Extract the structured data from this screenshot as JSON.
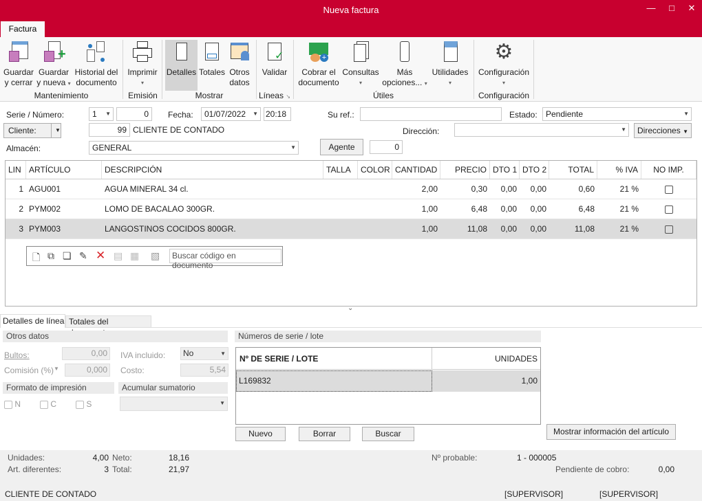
{
  "window": {
    "title": "Nueva factura",
    "tab": "Factura",
    "brand_color": "#c8002f"
  },
  "ribbon": {
    "buttons": [
      {
        "l1": "Guardar",
        "l2": "y cerrar"
      },
      {
        "l1": "Guardar",
        "l2": "y nueva"
      },
      {
        "l1": "Historial del",
        "l2": "documento"
      },
      {
        "l1": "Imprimir",
        "l2": ""
      },
      {
        "l1": "Detalles",
        "l2": ""
      },
      {
        "l1": "Totales",
        "l2": ""
      },
      {
        "l1": "Otros",
        "l2": "datos"
      },
      {
        "l1": "Validar",
        "l2": ""
      },
      {
        "l1": "Cobrar el",
        "l2": "documento"
      },
      {
        "l1": "Consultas",
        "l2": ""
      },
      {
        "l1": "Más",
        "l2": "opciones..."
      },
      {
        "l1": "Utilidades",
        "l2": ""
      },
      {
        "l1": "Configuración",
        "l2": ""
      }
    ],
    "groups": [
      "Mantenimiento",
      "Emisión",
      "Mostrar",
      "Líneas",
      "Útiles",
      "Configuración"
    ]
  },
  "form": {
    "serie_label": "Serie / Número:",
    "serie": "1",
    "numero": "0",
    "fecha_label": "Fecha:",
    "fecha": "01/07/2022",
    "hora": "20:18",
    "suref_label": "Su ref.:",
    "suref": "",
    "estado_label": "Estado:",
    "estado": "Pendiente",
    "cliente_label": "Cliente:",
    "cliente_code": "99",
    "cliente_name": "CLIENTE DE CONTADO",
    "direccion_label": "Dirección:",
    "direccion": "",
    "direcciones_btn": "Direcciones",
    "almacen_label": "Almacén:",
    "almacen": "GENERAL",
    "agente_btn": "Agente",
    "agente": "0"
  },
  "grid": {
    "columns": [
      "LIN",
      "ARTÍCULO",
      "DESCRIPCIÓN",
      "TALLA",
      "COLOR",
      "CANTIDAD",
      "PRECIO",
      "DTO 1",
      "DTO 2",
      "TOTAL",
      "% IVA",
      "NO IMP."
    ],
    "rows": [
      [
        "1",
        "AGU001",
        "AGUA MINERAL 34 cl.",
        "",
        "",
        "2,00",
        "0,30",
        "0,00",
        "0,00",
        "0,60",
        "21 %",
        false
      ],
      [
        "2",
        "PYM002",
        "LOMO DE BACALAO 300GR.",
        "",
        "",
        "1,00",
        "6,48",
        "0,00",
        "0,00",
        "6,48",
        "21 %",
        false
      ],
      [
        "3",
        "PYM003",
        "LANGOSTINOS COCIDOS 800GR.",
        "",
        "",
        "1,00",
        "11,08",
        "0,00",
        "0,00",
        "11,08",
        "21 %",
        false
      ]
    ],
    "search_placeholder": "Buscar código en documento"
  },
  "details": {
    "tabs": [
      "Detalles de línea",
      "Totales del documento"
    ],
    "otros_datos": "Otros datos",
    "bultos_label": "Bultos:",
    "bultos": "0,00",
    "iva_incl_label": "IVA incluido:",
    "iva_incl": "No",
    "comision_label": "Comisión (%)",
    "comision": "0,000",
    "costo_label": "Costo:",
    "costo": "5,54",
    "formato_label": "Formato de impresión",
    "fmt": [
      "N",
      "C",
      "S"
    ],
    "acumular_label": "Acumular sumatorio",
    "series_label": "Números de serie / lote",
    "series_cols": [
      "Nº DE SERIE / LOTE",
      "UNIDADES"
    ],
    "series_rows": [
      [
        "L169832",
        "1,00"
      ]
    ],
    "nuevo": "Nuevo",
    "borrar": "Borrar",
    "buscar": "Buscar",
    "mostrar_info": "Mostrar información del artículo"
  },
  "footer": {
    "unidades_label": "Unidades:",
    "unidades": "4,00",
    "neto_label": "Neto:",
    "neto": "18,16",
    "artdif_label": "Art. diferentes:",
    "artdif": "3",
    "total_label": "Total:",
    "total": "21,97",
    "nprob_label": "Nº probable:",
    "nprob": "1 - 000005",
    "pend_label": "Pendiente de cobro:",
    "pend": "0,00",
    "status_client": "CLIENTE DE CONTADO",
    "user1": "[SUPERVISOR]",
    "user2": "[SUPERVISOR]"
  }
}
